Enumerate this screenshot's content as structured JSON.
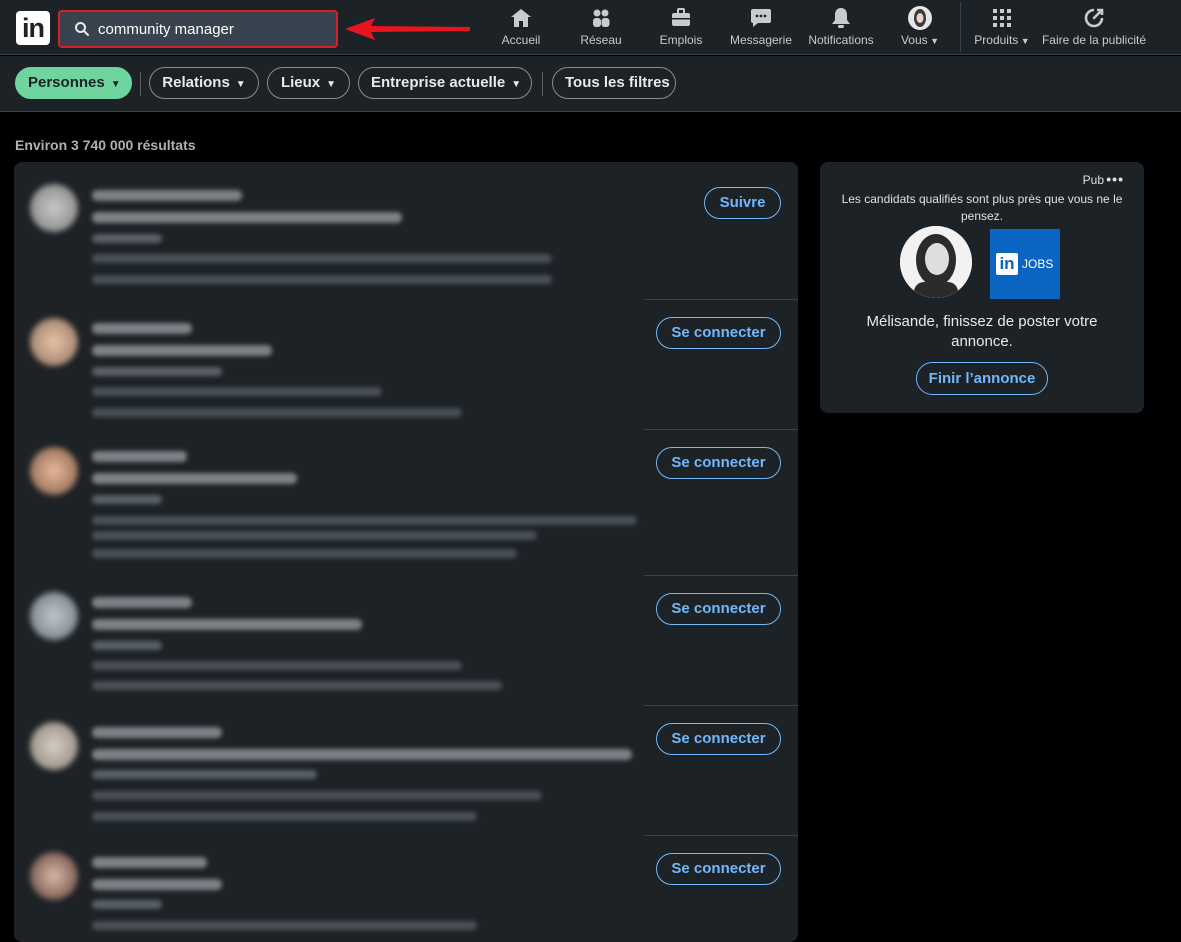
{
  "search": {
    "value": "community manager"
  },
  "nav": {
    "home": "Accueil",
    "network": "Réseau",
    "jobs": "Emplois",
    "messaging": "Messagerie",
    "notifications": "Notifications",
    "me": "Vous",
    "products": "Produits",
    "advertise": "Faire de la publicité"
  },
  "filters": {
    "people": "Personnes",
    "connections": "Relations",
    "locations": "Lieux",
    "current_company": "Entreprise actuelle",
    "all_filters": "Tous les filtres"
  },
  "results": {
    "count": "Environ 3 740 000 résultats",
    "actions": [
      "Suivre",
      "Se connecter",
      "Se connecter",
      "Se connecter",
      "Se connecter",
      "Se connecter"
    ]
  },
  "ad": {
    "label": "Pub",
    "more": "•••",
    "tagline": "Les candidats qualifiés sont plus près que vous ne le pensez.",
    "logo_text": "JOBS",
    "message": "Mélisande, finissez de poster votre annonce.",
    "button": "Finir l’annonce"
  },
  "colors": {
    "background": "#000000",
    "card": "#1d2226",
    "accent_green": "#6ed5a1",
    "link_blue": "#71b7fb",
    "highlight_red": "#d9202a"
  }
}
